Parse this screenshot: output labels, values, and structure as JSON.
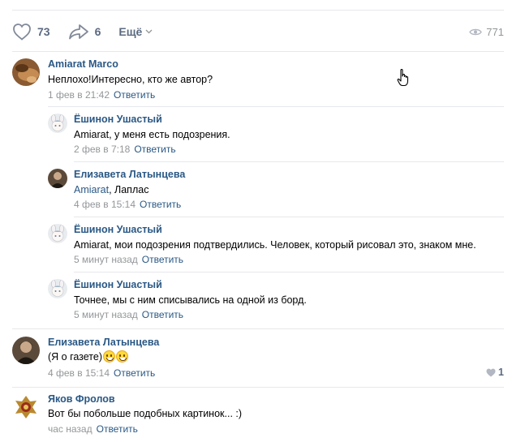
{
  "post_actions": {
    "likes": "73",
    "shares": "6",
    "more_label": "Ещё",
    "views": "771"
  },
  "reply_label": "Ответить",
  "comments": [
    {
      "author": "Amiarat Marco",
      "text": "Неплохо!Интересно, кто же автор?",
      "time": "1 фев в 21:42",
      "avatar": "photo-brown"
    },
    {
      "author": "Ёшинон Ушастый",
      "text": "Amiarat, у меня есть подозрения.",
      "time": "2 фев в 7:18",
      "avatar": "rabbit-girl"
    },
    {
      "author": "Елизавета Латынцева",
      "mention": "Amiarat",
      "text": ", Лаплас",
      "time": "4 фев в 15:14",
      "avatar": "dark-figure"
    },
    {
      "author": "Ёшинон Ушастый",
      "mention": "Amiarat",
      "text": ", мои подозрения подтвердились. Человек, который рисовал это, знаком мне.",
      "time": "5 минут назад",
      "avatar": "rabbit-girl"
    },
    {
      "author": "Ёшинон Ушастый",
      "text": "Точнее, мы с ним списывались на одной из борд.",
      "time": "5 минут назад",
      "avatar": "rabbit-girl"
    },
    {
      "author": "Елизавета Латынцева",
      "text": "(Я о газете)",
      "time": "4 фев в 15:14",
      "likes": "1",
      "avatar": "dark-figure"
    },
    {
      "author": "Яков Фролов",
      "text": "Вот бы побольше подобных картинок... :)",
      "time": "час назад",
      "avatar": "emblem"
    }
  ],
  "colors": {
    "link": "#2a5885",
    "meta": "#939699",
    "icon": "#5b6a80",
    "separator": "#e7e8ec"
  }
}
